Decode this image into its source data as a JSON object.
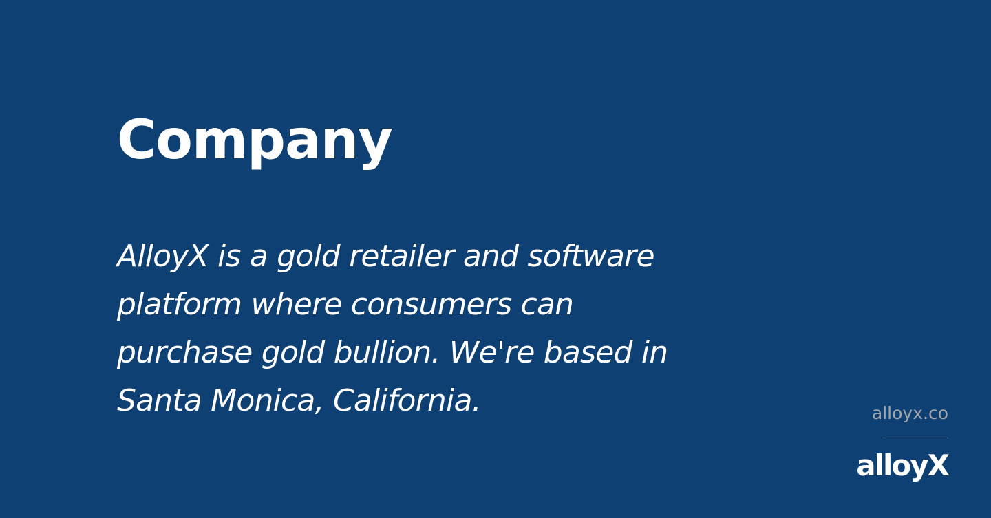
{
  "slide": {
    "title": "Company",
    "description_lines": [
      "AlloyX is a gold retailer and software",
      "platform where consumers can",
      "purchase gold bullion. We're based in",
      "Santa Monica, California."
    ]
  },
  "footer": {
    "website": "alloyx.co",
    "logo_text": "alloyX"
  },
  "colors": {
    "background": "#0f4074",
    "text": "#ffffff",
    "muted_text": "#a3a6ab",
    "divider": "#4a6f98"
  }
}
